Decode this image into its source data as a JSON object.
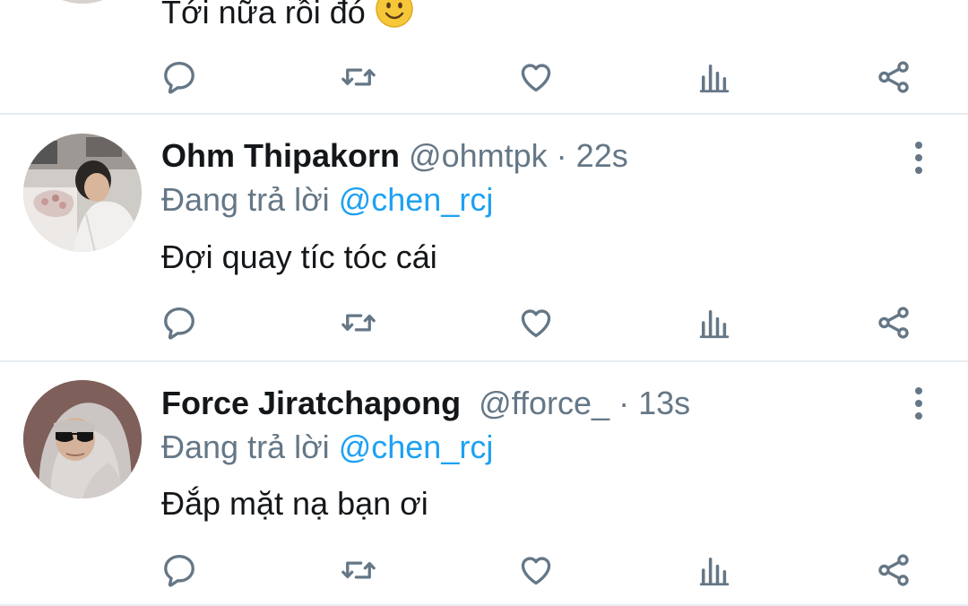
{
  "colors": {
    "text": "#14171a",
    "secondary": "#657786",
    "mention": "#1da1f2",
    "icon": "#657786",
    "divider": "#e6ecf0"
  },
  "tweets": [
    {
      "text": "Tới nữa rồi đó",
      "emoji": "slightly-smiling-face",
      "actions": [
        "reply-icon",
        "retweet-icon",
        "like-icon",
        "stats-icon",
        "share-icon"
      ]
    },
    {
      "name": "Ohm Thipakorn",
      "handle": "@ohmtpk",
      "separator": "·",
      "time": "22s",
      "reply_prefix": "Đang trả lời",
      "reply_to": "@chen_rcj",
      "text": "Đợi quay tíc tóc cái",
      "actions": [
        "reply-icon",
        "retweet-icon",
        "like-icon",
        "stats-icon",
        "share-icon"
      ]
    },
    {
      "name": "Force Jiratchapong",
      "handle": "@fforce_",
      "separator": "·",
      "time": "13s",
      "reply_prefix": "Đang trả lời",
      "reply_to": "@chen_rcj",
      "text": "Đắp mặt nạ bạn ơi",
      "actions": [
        "reply-icon",
        "retweet-icon",
        "like-icon",
        "stats-icon",
        "share-icon"
      ]
    }
  ]
}
